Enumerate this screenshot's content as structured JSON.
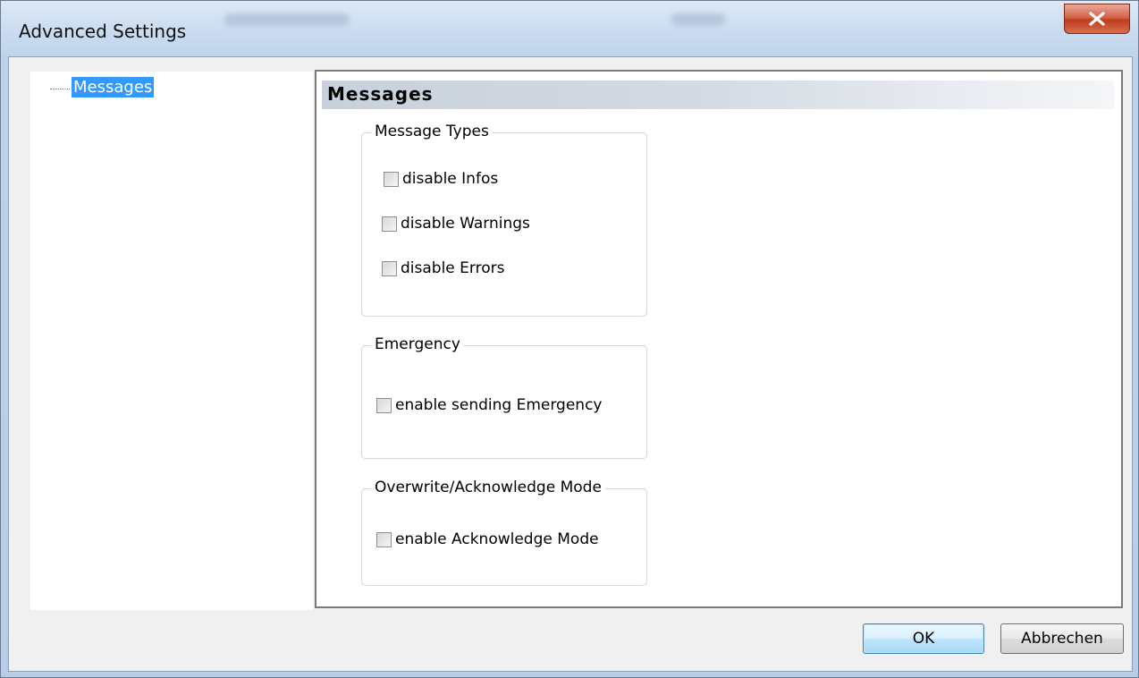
{
  "window": {
    "title": "Advanced Settings"
  },
  "tree": {
    "items": [
      {
        "label": "Messages",
        "selected": true
      }
    ]
  },
  "panel": {
    "header": "Messages",
    "groups": [
      {
        "legend": "Message Types",
        "checkboxes": [
          {
            "label": "disable Infos",
            "checked": false
          },
          {
            "label": "disable Warnings",
            "checked": false
          },
          {
            "label": "disable Errors",
            "checked": false
          }
        ]
      },
      {
        "legend": "Emergency",
        "checkboxes": [
          {
            "label": "enable sending Emergency",
            "checked": false
          }
        ]
      },
      {
        "legend": "Overwrite/Acknowledge Mode",
        "checkboxes": [
          {
            "label": "enable Acknowledge Mode",
            "checked": false
          }
        ]
      }
    ]
  },
  "buttons": {
    "ok_label": "OK",
    "cancel_label": "Abbrechen"
  },
  "colors": {
    "selection": "#3399ff",
    "close_button": "#c23b1f",
    "ok_border": "#3c7fb1"
  }
}
